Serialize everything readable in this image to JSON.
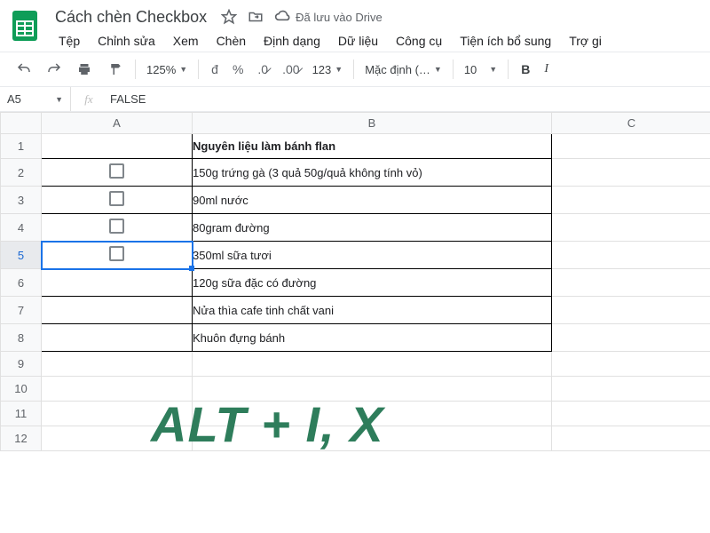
{
  "header": {
    "doc_title": "Cách chèn Checkbox",
    "save_status": "Đã lưu vào Drive"
  },
  "menu": {
    "file": "Tệp",
    "edit": "Chỉnh sửa",
    "view": "Xem",
    "insert": "Chèn",
    "format": "Định dạng",
    "data": "Dữ liệu",
    "tools": "Công cụ",
    "addons": "Tiện ích bổ sung",
    "help": "Trợ gi"
  },
  "toolbar": {
    "zoom": "125%",
    "currency": "đ",
    "percent": "%",
    "dec_dec": ".0̷",
    "inc_dec": ".00̷",
    "num_fmt": "123",
    "font": "Mặc định (…",
    "font_size": "10",
    "bold": "B",
    "italic": "I"
  },
  "formula_bar": {
    "cell_ref": "A5",
    "fx": "fx",
    "value": "FALSE"
  },
  "columns": {
    "A": "A",
    "B": "B",
    "C": "C"
  },
  "rows": {
    "r1": "1",
    "r2": "2",
    "r3": "3",
    "r4": "4",
    "r5": "5",
    "r6": "6",
    "r7": "7",
    "r8": "8",
    "r9": "9",
    "r10": "10",
    "r11": "11",
    "r12": "12"
  },
  "cells": {
    "B1": "Nguyên liệu làm bánh flan",
    "B2": "150g trứng gà (3 quả 50g/quả không tính vỏ)",
    "B3": "90ml nước",
    "B4": "80gram đường",
    "B5": "350ml sữa tươi",
    "B6": "120g sữa đặc có đường",
    "B7": "Nửa thìa cafe tinh chất vani",
    "B8": "Khuôn đựng bánh"
  },
  "checkboxes": {
    "A2": false,
    "A3": false,
    "A4": false,
    "A5": false
  },
  "overlay": "ALT + I, X"
}
